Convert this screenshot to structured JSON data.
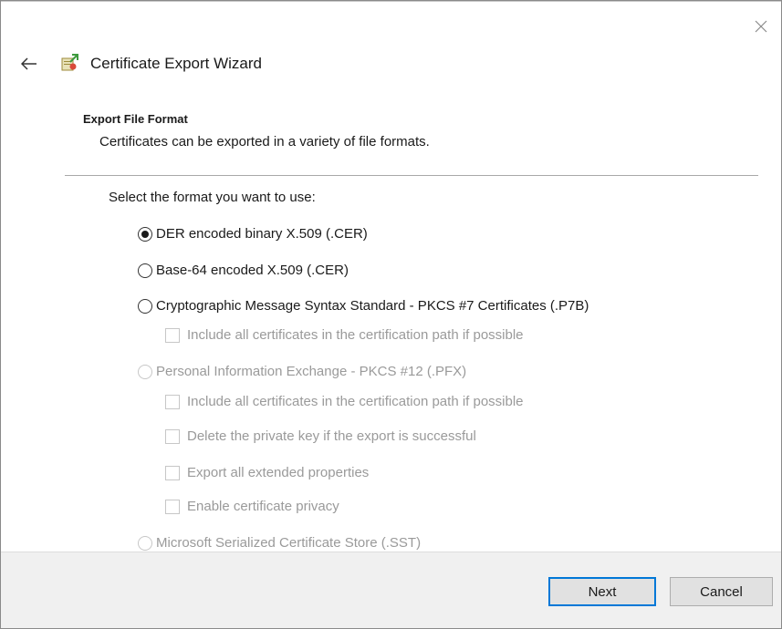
{
  "window": {
    "title": "Certificate Export Wizard"
  },
  "icons": {
    "close": "close-icon",
    "back": "back-arrow-icon",
    "wizard": "certificate-wizard-icon"
  },
  "section": {
    "title": "Export File Format",
    "subtitle": "Certificates can be exported in a variety of file formats."
  },
  "prompt": "Select the format you want to use:",
  "options": {
    "der": {
      "label": "DER encoded binary X.509 (.CER)",
      "selected": true,
      "enabled": true
    },
    "base64": {
      "label": "Base-64 encoded X.509 (.CER)",
      "selected": false,
      "enabled": true
    },
    "pkcs7": {
      "label": "Cryptographic Message Syntax Standard - PKCS #7 Certificates (.P7B)",
      "selected": false,
      "enabled": true
    },
    "pkcs7_include_all": {
      "label": "Include all certificates in the certification path if possible",
      "checked": false,
      "enabled": false
    },
    "pfx": {
      "label": "Personal Information Exchange - PKCS #12 (.PFX)",
      "selected": false,
      "enabled": false
    },
    "pfx_include_all": {
      "label": "Include all certificates in the certification path if possible",
      "checked": false,
      "enabled": false
    },
    "pfx_delete_key": {
      "label": "Delete the private key if the export is successful",
      "checked": false,
      "enabled": false
    },
    "pfx_export_props": {
      "label": "Export all extended properties",
      "checked": false,
      "enabled": false
    },
    "pfx_privacy": {
      "label": "Enable certificate privacy",
      "checked": false,
      "enabled": false
    },
    "sst": {
      "label": "Microsoft Serialized Certificate Store (.SST)",
      "selected": false,
      "enabled": false
    }
  },
  "footer": {
    "next_label": "Next",
    "cancel_label": "Cancel"
  },
  "colors": {
    "accent": "#0078d7",
    "footer_bg": "#f0f0f0",
    "disabled_text": "#9a9a9a"
  }
}
